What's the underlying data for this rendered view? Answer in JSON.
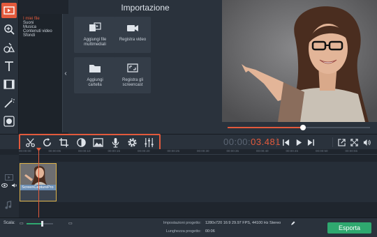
{
  "sidebar": {
    "tools": [
      "import-icon",
      "magic-zoom-icon",
      "shapes-icon",
      "text-icon",
      "filters-icon",
      "transitions-icon",
      "more-tools-icon"
    ],
    "file_categories": [
      "I miei file",
      "Suoni",
      "Musica",
      "Contenuti video",
      "Sfondi"
    ],
    "selected_category": "I miei file"
  },
  "import": {
    "title": "Importazione",
    "buttons": [
      {
        "label": "Aggiungi file\nmultimediali",
        "icon": "media-files-icon"
      },
      {
        "label": "Registra video",
        "icon": "camera-icon"
      },
      {
        "label": "Aggiungi\ncartella",
        "icon": "folder-icon"
      },
      {
        "label": "Registra gli\nscreencast",
        "icon": "screencast-icon"
      }
    ]
  },
  "player": {
    "timecode_dim": "00:00:",
    "timecode_hot": "03.481",
    "progress": 0.53
  },
  "edit_tools": [
    "cut-icon",
    "rotate-icon",
    "crop-icon",
    "color-adjust-icon",
    "image-icon",
    "microphone-icon",
    "settings-icon",
    "equalizer-icon"
  ],
  "ruler": {
    "labels": [
      "00:00:00",
      "00:00:05",
      "00:00:10",
      "00:00:15",
      "00:00:20",
      "00:00:25",
      "00:00:30",
      "00:00:35",
      "00:00:40",
      "00:00:45",
      "00:00:50",
      "00:00:55"
    ]
  },
  "timeline": {
    "clip_name": "ScreenCapturePro"
  },
  "footer": {
    "scale_label": "Scala:",
    "zoom_level": 0.55,
    "settings_label": "Impostazioni progetto:",
    "settings_value": "1280x720 16:9 29.97 FPS, 44100 Hz Stereo",
    "length_label": "Lunghezza progetto:",
    "length_value": "00:06",
    "export_label": "Esporta"
  },
  "colors": {
    "accent": "#e35a3c",
    "export": "#2fa86f",
    "clip_border": "#e0b44a"
  }
}
